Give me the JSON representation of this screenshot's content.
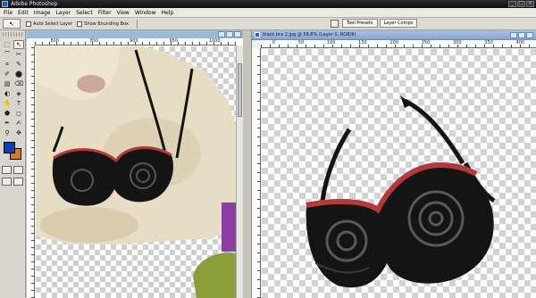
{
  "app": {
    "title": "Adobe Photoshop",
    "window_buttons": [
      "_",
      "□",
      "×"
    ]
  },
  "menu": [
    "File",
    "Edit",
    "Image",
    "Layer",
    "Select",
    "Filter",
    "View",
    "Window",
    "Help"
  ],
  "options_bar": {
    "tool_glyph": "↖",
    "auto_select_label": "Auto Select Layer",
    "show_bounding_label": "Show Bounding Box",
    "tabs": [
      "Tool Presets",
      "Layer Comps"
    ]
  },
  "toolbox": {
    "tools": [
      "⬚",
      "↖",
      "⌒",
      "✂",
      "⌗",
      "✎",
      "✐",
      "⬤",
      "▧",
      "⌫",
      "◐",
      "◈",
      "✋",
      "T",
      "⬟",
      "◻",
      "✒",
      "✍",
      "⚲",
      "✥"
    ],
    "foreground_color": "#0e3fb5",
    "background_color": "#d97b1b"
  },
  "doc_left": {
    "ruler_labels": [
      "800",
      "850",
      "900",
      "950",
      "1000"
    ]
  },
  "doc_right": {
    "title": "black bra 2.jpg @ 58.8% (Layer 0, RGB/8)",
    "ruler_labels": [
      "0",
      "50",
      "100",
      "150",
      "200",
      "250",
      "300",
      "350",
      "400"
    ]
  },
  "colors": {
    "bra": "#141414",
    "trim": "#b33a3a",
    "lace": "#555555",
    "wool": "#e7dcc4",
    "boot": "#8c9e3a",
    "purple": "#8a3ca0"
  }
}
